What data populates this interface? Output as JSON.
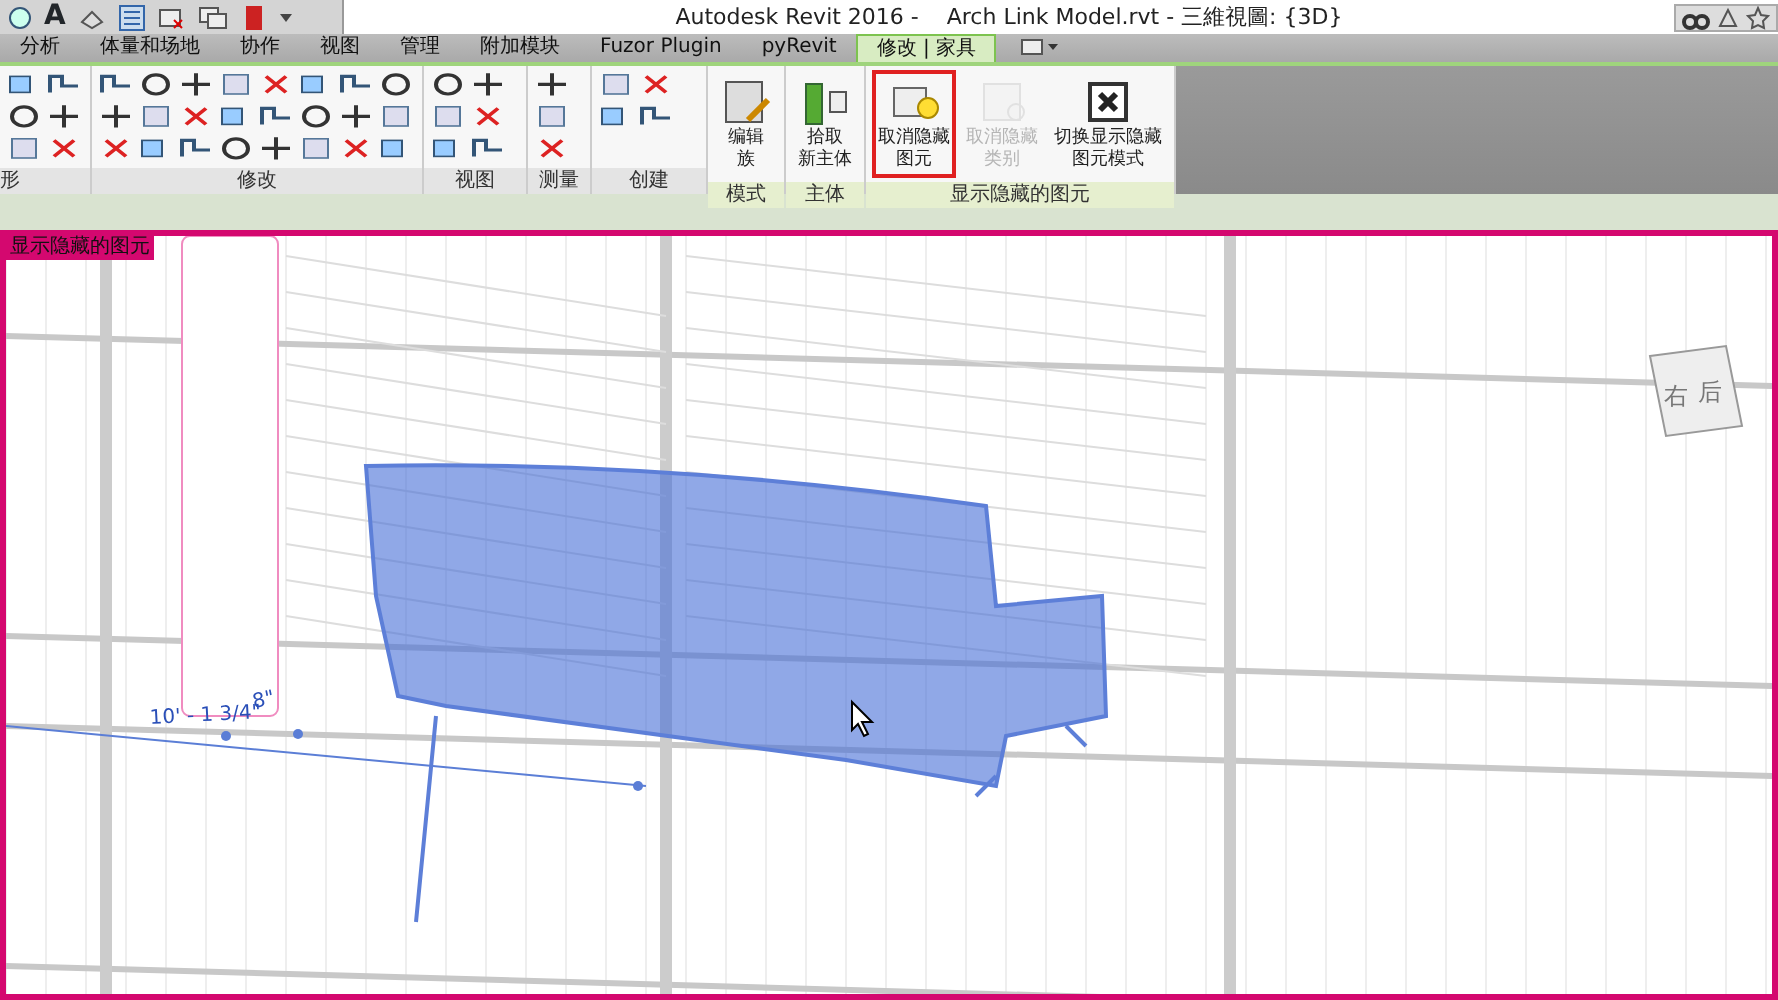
{
  "window": {
    "title": "Autodesk Revit 2016 -    Arch Link Model.rvt - 三維視圖: {3D}"
  },
  "quick_access": {
    "text_tool": "A"
  },
  "tabs": [
    {
      "label": "分析",
      "selected": false
    },
    {
      "label": "体量和场地",
      "selected": false
    },
    {
      "label": "协作",
      "selected": false
    },
    {
      "label": "视图",
      "selected": false
    },
    {
      "label": "管理",
      "selected": false
    },
    {
      "label": "附加模块",
      "selected": false
    },
    {
      "label": "Fuzor Plugin",
      "selected": false
    },
    {
      "label": "pyRevit",
      "selected": false
    },
    {
      "label": "修改 | 家具",
      "selected": true
    }
  ],
  "ribbon": {
    "panels": [
      {
        "label": "形",
        "kind": "tools",
        "contextual": false
      },
      {
        "label": "修改",
        "kind": "tools",
        "contextual": false
      },
      {
        "label": "视图",
        "kind": "tools",
        "contextual": false
      },
      {
        "label": "测量",
        "kind": "tools",
        "contextual": false
      },
      {
        "label": "创建",
        "kind": "tools",
        "contextual": false
      },
      {
        "label": "模式",
        "kind": "buttons",
        "contextual": true,
        "buttons": [
          {
            "label_lines": [
              "编辑",
              "族"
            ],
            "highlighted": false,
            "disabled": false
          }
        ]
      },
      {
        "label": "主体",
        "kind": "buttons",
        "contextual": true,
        "buttons": [
          {
            "label_lines": [
              "拾取",
              "新主体"
            ],
            "highlighted": false,
            "disabled": false
          }
        ]
      },
      {
        "label": "显示隐藏的图元",
        "kind": "buttons",
        "contextual": true,
        "buttons": [
          {
            "label_lines": [
              "取消隐藏",
              "图元"
            ],
            "highlighted": true,
            "disabled": false
          },
          {
            "label_lines": [
              "取消隐藏",
              "类别"
            ],
            "highlighted": false,
            "disabled": true
          },
          {
            "label_lines": [
              "切换显示隐藏",
              "图元模式"
            ],
            "highlighted": false,
            "disabled": false
          }
        ]
      }
    ]
  },
  "view": {
    "mode_label": "显示隐藏的图元",
    "dimension_texts": [
      "10' - 1 3/4\"",
      "8\""
    ],
    "viewcube_faces": [
      "右",
      "后"
    ]
  }
}
